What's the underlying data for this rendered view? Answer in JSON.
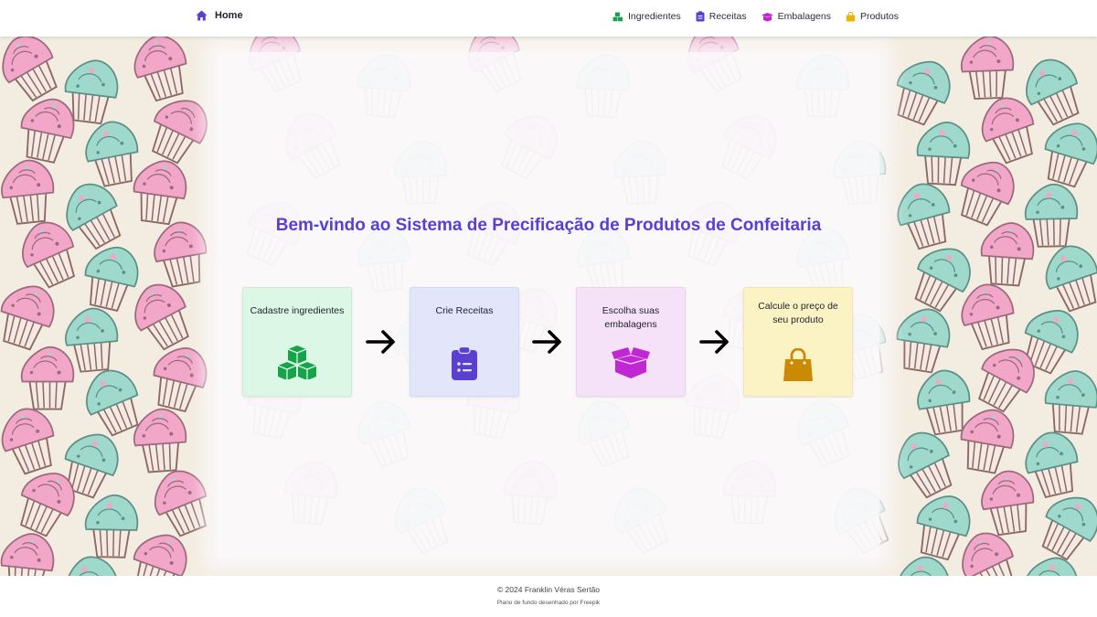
{
  "nav": {
    "home_label": "Home",
    "links": [
      {
        "label": "Ingredientes",
        "icon": "cubes-icon",
        "color": "#1f9d55"
      },
      {
        "label": "Receitas",
        "icon": "clipboard-icon",
        "color": "#5b40d0"
      },
      {
        "label": "Embalagens",
        "icon": "box-open-icon",
        "color": "#c026d3"
      },
      {
        "label": "Produtos",
        "icon": "shopping-bag-icon",
        "color": "#eab308"
      }
    ]
  },
  "main": {
    "title": "Bem-vindo ao Sistema de Precificação de Produtos de Confeitaria",
    "steps": [
      {
        "label": "Cadastre ingredientes",
        "icon": "cubes-icon",
        "bg": "#dcf7e6",
        "color": "#16a34a"
      },
      {
        "label": "Crie Receitas",
        "icon": "clipboard-list-icon",
        "bg": "#e3e5fa",
        "color": "#5b40d0"
      },
      {
        "label": "Escolha suas embalagens",
        "icon": "box-open-icon",
        "bg": "#f6e2f8",
        "color": "#c026d3"
      },
      {
        "label": "Calcule o preço de seu produto",
        "icon": "shopping-bag-icon",
        "bg": "#fcf3c4",
        "color": "#ca8a04"
      }
    ],
    "arrow_icon": "arrow-right-icon"
  },
  "footer": {
    "copyright": "© 2024 Franklin Véras Sertão",
    "credit": "Plano de fundo desenhado por Freepik"
  },
  "colors": {
    "title": "#5b40d0",
    "background": "#f3ece0",
    "cupcake_pink": "#f2a6c8",
    "cupcake_teal": "#9ed9cc",
    "cupcake_wrapper": "#b59a90"
  }
}
